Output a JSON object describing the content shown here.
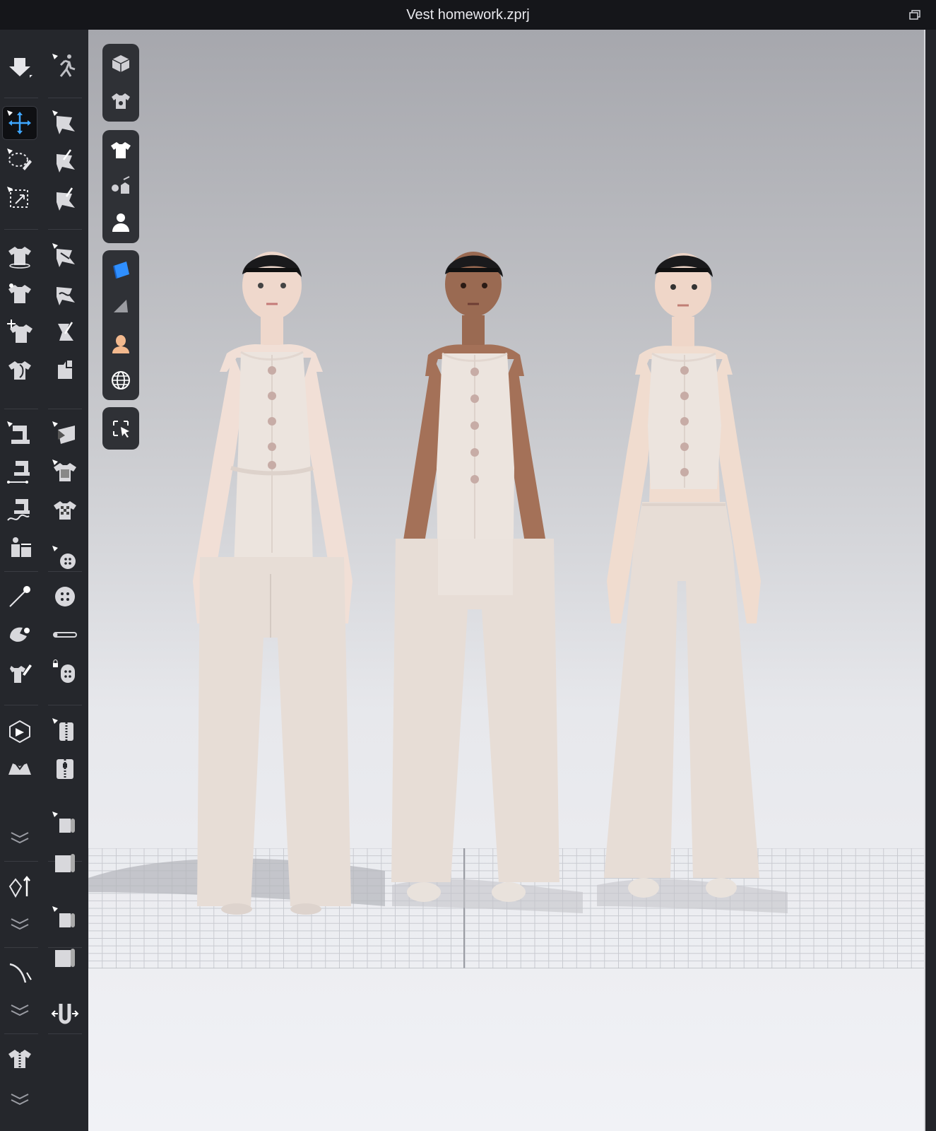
{
  "window": {
    "title": "Vest homework.zprj"
  },
  "colors": {
    "toolbar_bg": "#25272c",
    "title_bg": "#15161a",
    "accent_blue": "#3ea6ff",
    "garment": "#e8dfda"
  },
  "left_toolbar": {
    "tools": [
      "simulate-icon",
      "animation-icon",
      "move-gizmo-icon",
      "edit-pattern-icon",
      "lasso-select-icon",
      "edit-curve-icon",
      "box-select-icon",
      "edit-point-icon",
      "garment-select-icon",
      "segment-sewing-icon",
      "garment-pin-icon",
      "free-sewing-icon",
      "garment-transform-icon",
      "edit-sewing-icon",
      "garment-flatten-icon",
      "fold-arrange-icon",
      "stitch-icon",
      "puckering-icon",
      "topstitch-icon",
      "texture-edit-icon",
      "seam-taping-icon",
      "texture-pattern-icon",
      "avatar-measure-icon",
      "button-add-icon",
      "pin-icon",
      "button-icon",
      "tack-icon",
      "buttonhole-icon",
      "brush-icon",
      "lock-button-icon",
      "import-icon",
      "zipper-select-icon",
      "jacket-icon",
      "zipper-icon",
      "expand-more-icon",
      "shape-select-icon",
      "lift-icon",
      "shape-icon",
      "expand-more-icon",
      "trim-select-icon",
      "measure-icon",
      "trim-icon",
      "expand-more-icon",
      "fit-icon",
      "tape-icon",
      "expand-more-icon"
    ]
  },
  "viewport_toolbar": {
    "groups": [
      [
        "3d-box-icon",
        "garment-display-icon"
      ],
      [
        "tshirt-icon",
        "trims-icon",
        "avatar-icon"
      ],
      [
        "fabric-blue-icon",
        "fabric-gray-icon",
        "skin-icon",
        "globe-icon"
      ],
      [
        "select-cursor-icon"
      ]
    ]
  },
  "scene": {
    "avatars": [
      "avatar-1",
      "avatar-2",
      "avatar-3"
    ]
  }
}
